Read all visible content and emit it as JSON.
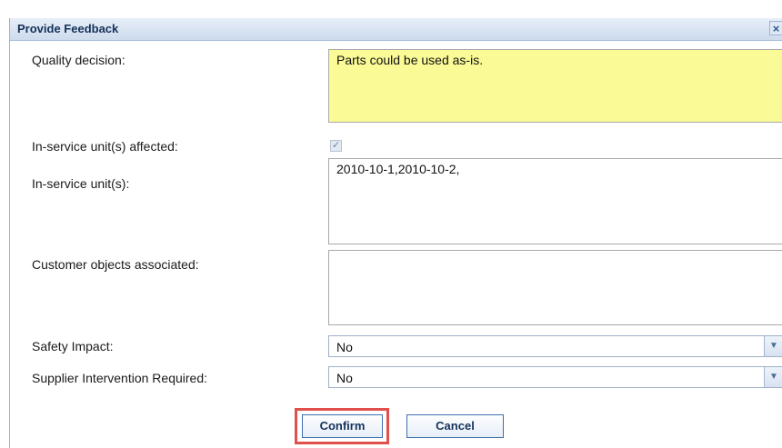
{
  "dialog": {
    "title": "Provide Feedback",
    "close_icon": "close-icon",
    "close_glyph": "×"
  },
  "fields": {
    "quality_decision": {
      "label": "Quality decision:",
      "value": "Parts could be used as-is."
    },
    "in_service_affected": {
      "label": "In-service unit(s) affected:",
      "checked": true,
      "check_glyph": "✓"
    },
    "in_service_units": {
      "label": "In-service unit(s):",
      "value": "2010-10-1,2010-10-2,"
    },
    "customer_objects": {
      "label": "Customer objects associated:",
      "value": ""
    },
    "safety_impact": {
      "label": "Safety Impact:",
      "selected": "No",
      "icon": "chevron-down-icon",
      "glyph": "▼"
    },
    "supplier_intervention": {
      "label": "Supplier Intervention Required:",
      "selected": "No",
      "icon": "chevron-down-icon",
      "glyph": "▼"
    }
  },
  "buttons": {
    "confirm": "Confirm",
    "cancel": "Cancel"
  },
  "colors": {
    "highlight": "#e0504d",
    "decision_background": "#fafa96",
    "title_text": "#15325a"
  }
}
